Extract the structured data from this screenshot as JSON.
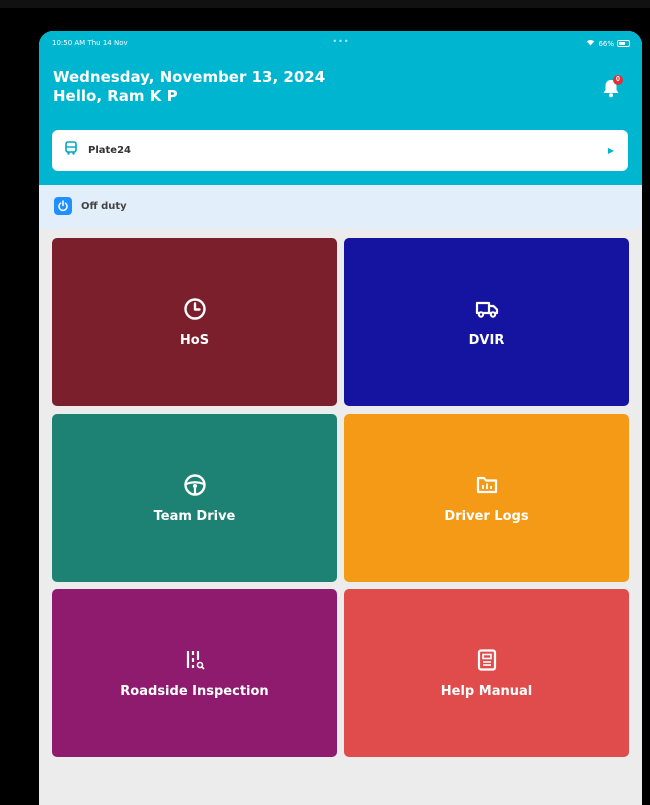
{
  "status_bar": {
    "time": "10:50 AM",
    "day": "Thu 14 Nov",
    "dots": "•••",
    "battery": "66%",
    "battery_fraction": 0.66
  },
  "header": {
    "date": "Wednesday, November 13, 2024",
    "greeting": "Hello, Ram K P",
    "notification_badge": "0",
    "background": "#00b5cf"
  },
  "vehicle": {
    "name": "Plate24"
  },
  "duty_status": {
    "label": "Off duty",
    "color": "#1e90ff"
  },
  "tiles": [
    {
      "label": "HoS",
      "icon": "clock-icon",
      "color": "#7b1f2c"
    },
    {
      "label": "DVIR",
      "icon": "truck-icon",
      "color": "#1414a0"
    },
    {
      "label": "Team Drive",
      "icon": "steering-wheel-icon",
      "color": "#1d8273"
    },
    {
      "label": "Driver Logs",
      "icon": "folder-chart-icon",
      "color": "#f59a17"
    },
    {
      "label": "Roadside Inspection",
      "icon": "inspection-icon",
      "color": "#8f1b6f"
    },
    {
      "label": "Help Manual",
      "icon": "manual-icon",
      "color": "#e04b4b"
    }
  ]
}
